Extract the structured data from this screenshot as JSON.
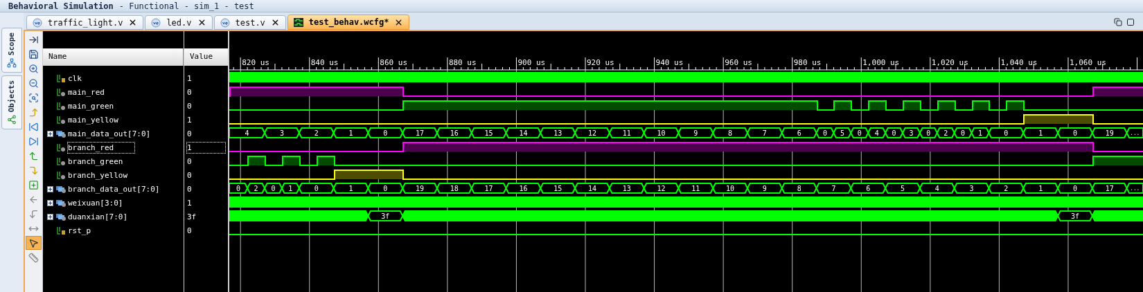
{
  "window": {
    "title": "Behavioral Simulation",
    "subtitle": "- Functional - sim_1 - test"
  },
  "side_tabs": [
    {
      "label": "Scope",
      "kind": "scope"
    },
    {
      "label": "Objects",
      "kind": "objects"
    }
  ],
  "tabs": [
    {
      "label": "traffic_light.v",
      "kind": "verilog",
      "selected": false
    },
    {
      "label": "led.v",
      "kind": "verilog",
      "selected": false
    },
    {
      "label": "test.v",
      "kind": "verilog",
      "selected": false
    },
    {
      "label": "test_behav.wcfg*",
      "kind": "waveform",
      "selected": true
    }
  ],
  "toolbar": [
    {
      "kind": "float",
      "selected": false
    },
    {
      "kind": "save",
      "selected": false
    },
    {
      "kind": "zoom_in",
      "selected": false
    },
    {
      "kind": "zoom_out",
      "selected": false
    },
    {
      "kind": "zoom_fit",
      "selected": false
    },
    {
      "kind": "go_start",
      "selected": false
    },
    {
      "kind": "prev_transition",
      "selected": false
    },
    {
      "kind": "next_transition",
      "selected": false
    },
    {
      "kind": "prev_edge",
      "selected": false
    },
    {
      "kind": "next_edge",
      "selected": false
    },
    {
      "kind": "add_marker",
      "selected": false
    },
    {
      "kind": "prev_marker",
      "selected": false
    },
    {
      "kind": "next_marker",
      "selected": false
    },
    {
      "kind": "swap",
      "selected": false
    },
    {
      "kind": "snap",
      "selected": true
    },
    {
      "kind": "ruler",
      "selected": false
    }
  ],
  "columns": [
    "Name",
    "Value"
  ],
  "time_ticks": [
    "820 us",
    "840 us",
    "860 us",
    "880 us",
    "900 us",
    "920 us",
    "940 us",
    "960 us",
    "980 us",
    "1,000 us",
    "1,020 us",
    "1,040 us",
    "1,060 us"
  ],
  "signals": [
    {
      "name": "clk",
      "kind": "clock",
      "value": "1",
      "selected": false,
      "color": "#00ff00"
    },
    {
      "name": "main_red",
      "kind": "bit",
      "value": "0",
      "selected": false,
      "color": "#ff00ff"
    },
    {
      "name": "main_green",
      "kind": "bit",
      "value": "0",
      "selected": false,
      "color": "#00ff00"
    },
    {
      "name": "main_yellow",
      "kind": "bit",
      "value": "1",
      "selected": false,
      "color": "#ffff00"
    },
    {
      "name": "main_data_out[7:0]",
      "kind": "bus",
      "expanded": false,
      "value": "0",
      "selected": false,
      "color": "#00ff00",
      "segments": [
        {
          "value": "4"
        },
        {
          "value": "3"
        },
        {
          "value": "2"
        },
        {
          "value": "1"
        },
        {
          "value": "0"
        },
        {
          "value": "17"
        },
        {
          "value": "16"
        },
        {
          "value": "15"
        },
        {
          "value": "14"
        },
        {
          "value": "13"
        },
        {
          "value": "12"
        },
        {
          "value": "11"
        },
        {
          "value": "10"
        },
        {
          "value": "9"
        },
        {
          "value": "8"
        },
        {
          "value": "7"
        },
        {
          "value": "6"
        },
        {
          "value": "0"
        },
        {
          "value": "5"
        },
        {
          "value": "0"
        },
        {
          "value": "4"
        },
        {
          "value": "0"
        },
        {
          "value": "3"
        },
        {
          "value": "0"
        },
        {
          "value": "2"
        },
        {
          "value": "0"
        },
        {
          "value": "1"
        },
        {
          "value": "0"
        },
        {
          "value": "1"
        },
        {
          "value": "0"
        },
        {
          "value": "19"
        },
        {
          "value": "..."
        }
      ]
    },
    {
      "name": "branch_red",
      "kind": "bit",
      "value": "1",
      "selected": true,
      "color": "#ff00ff"
    },
    {
      "name": "branch_green",
      "kind": "bit",
      "value": "0",
      "selected": false,
      "color": "#00ff00"
    },
    {
      "name": "branch_yellow",
      "kind": "bit",
      "value": "0",
      "selected": false,
      "color": "#ffff00"
    },
    {
      "name": "branch_data_out[7:0]",
      "kind": "bus",
      "expanded": false,
      "value": "0",
      "selected": false,
      "color": "#00ff00",
      "segments": [
        {
          "value": "0"
        },
        {
          "value": "2"
        },
        {
          "value": "0"
        },
        {
          "value": "1"
        },
        {
          "value": "0"
        },
        {
          "value": "1"
        },
        {
          "value": "0"
        },
        {
          "value": "19"
        },
        {
          "value": "18"
        },
        {
          "value": "17"
        },
        {
          "value": "16"
        },
        {
          "value": "15"
        },
        {
          "value": "14"
        },
        {
          "value": "13"
        },
        {
          "value": "12"
        },
        {
          "value": "11"
        },
        {
          "value": "10"
        },
        {
          "value": "9"
        },
        {
          "value": "8"
        },
        {
          "value": "7"
        },
        {
          "value": "6"
        },
        {
          "value": "5"
        },
        {
          "value": "4"
        },
        {
          "value": "3"
        },
        {
          "value": "2"
        },
        {
          "value": "1"
        },
        {
          "value": "0"
        },
        {
          "value": "17"
        },
        {
          "value": "..."
        }
      ]
    },
    {
      "name": "weixuan[3:0]",
      "kind": "bus",
      "expanded": false,
      "value": "1",
      "selected": false,
      "color": "#00ff00",
      "segments": [
        {
          "kind": "solid"
        }
      ]
    },
    {
      "name": "duanxian[7:0]",
      "kind": "bus",
      "expanded": false,
      "value": "3f",
      "selected": false,
      "color": "#00ff00",
      "segments": [
        {
          "kind": "solid"
        },
        {
          "value": "3f"
        },
        {
          "kind": "solid"
        },
        {
          "value": "3f"
        },
        {
          "kind": "solid"
        }
      ]
    },
    {
      "name": "rst_p",
      "kind": "input",
      "value": "0",
      "selected": false,
      "color": "#00ff00"
    }
  ]
}
